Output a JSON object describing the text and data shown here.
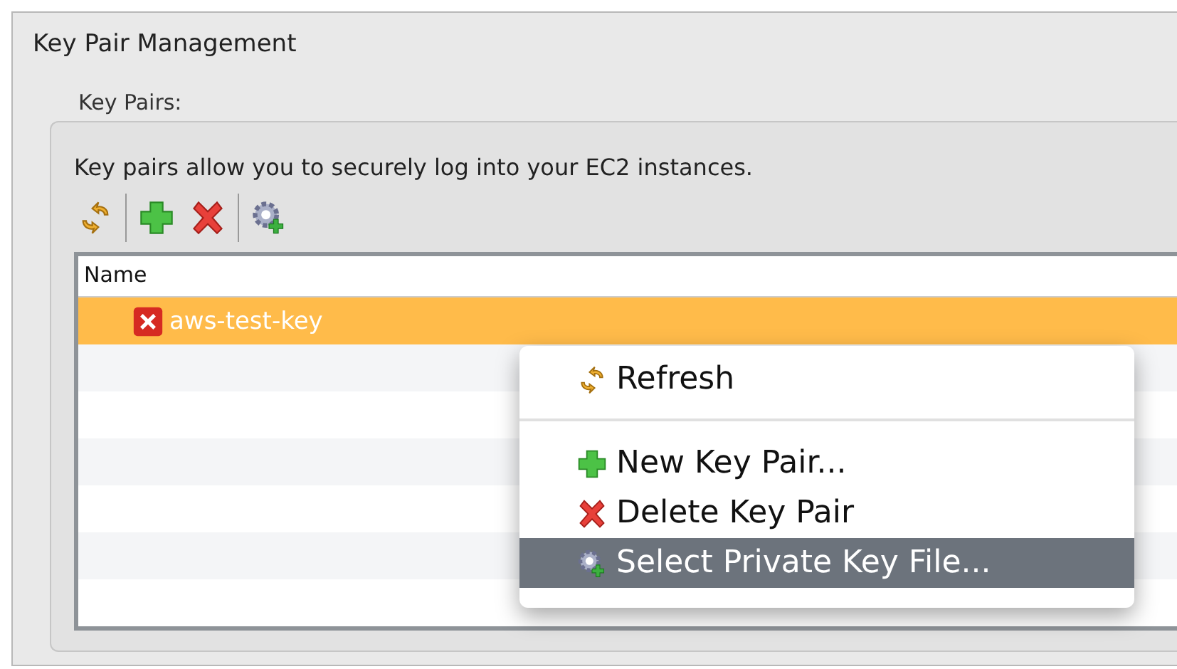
{
  "panel": {
    "title": "Key Pair Management"
  },
  "group": {
    "label": "Key Pairs:",
    "description": "Key pairs allow you to securely log into your EC2 instances."
  },
  "toolbar": [
    {
      "kind": "refresh"
    },
    {
      "kind": "separator"
    },
    {
      "kind": "add"
    },
    {
      "kind": "delete"
    },
    {
      "kind": "separator"
    },
    {
      "kind": "select-key"
    }
  ],
  "table": {
    "columns": [
      "Name"
    ],
    "rows": [
      {
        "name": "aws-test-key",
        "selected": true
      }
    ]
  },
  "context_menu": [
    {
      "kind": "refresh",
      "label": "Refresh",
      "selected": false
    },
    {
      "kind": "separator"
    },
    {
      "kind": "add",
      "label": "New Key Pair...",
      "selected": false
    },
    {
      "kind": "delete",
      "label": "Delete Key Pair",
      "selected": false
    },
    {
      "kind": "select-key",
      "label": "Select Private Key File...",
      "selected": true
    }
  ]
}
